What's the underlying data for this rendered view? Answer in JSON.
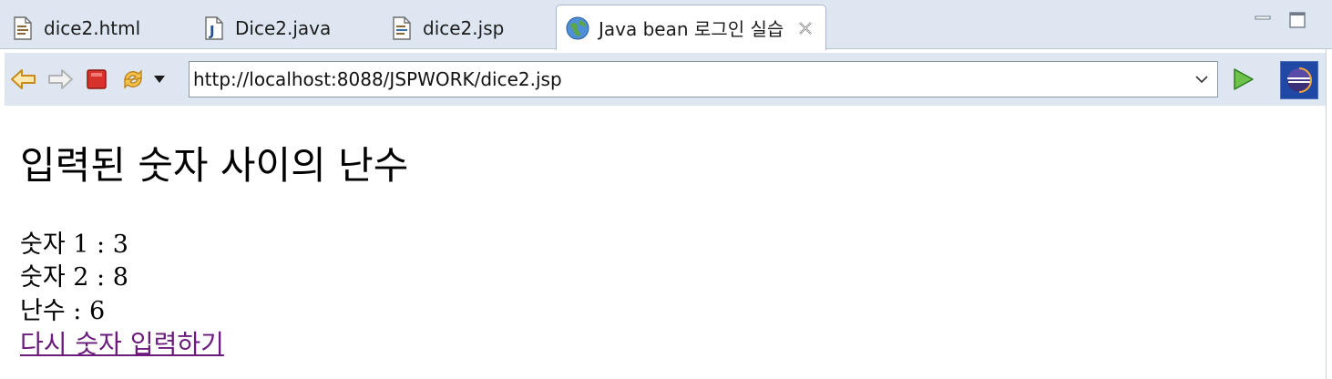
{
  "tabs": [
    {
      "label": "dice2.html",
      "icon": "html-file-icon"
    },
    {
      "label": "Dice2.java",
      "icon": "java-file-icon"
    },
    {
      "label": "dice2.jsp",
      "icon": "jsp-file-icon"
    },
    {
      "label": "Java bean 로그인 실습",
      "icon": "globe-icon",
      "active": true
    }
  ],
  "toolbar": {
    "url": "http://localhost:8088/JSPWORK/dice2.jsp"
  },
  "page": {
    "heading": "입력된 숫자 사이의 난수",
    "num1_label": "숫자",
    "num1_value": "1 : 3",
    "num2_label": "숫자",
    "num2_value": "2 : 8",
    "random_label": "난수",
    "random_value": ": 6",
    "retry_link": "다시 숫자 입력하기"
  },
  "colors": {
    "chrome_bg": "#dde6f1",
    "link_visited": "#6b1b7b"
  }
}
